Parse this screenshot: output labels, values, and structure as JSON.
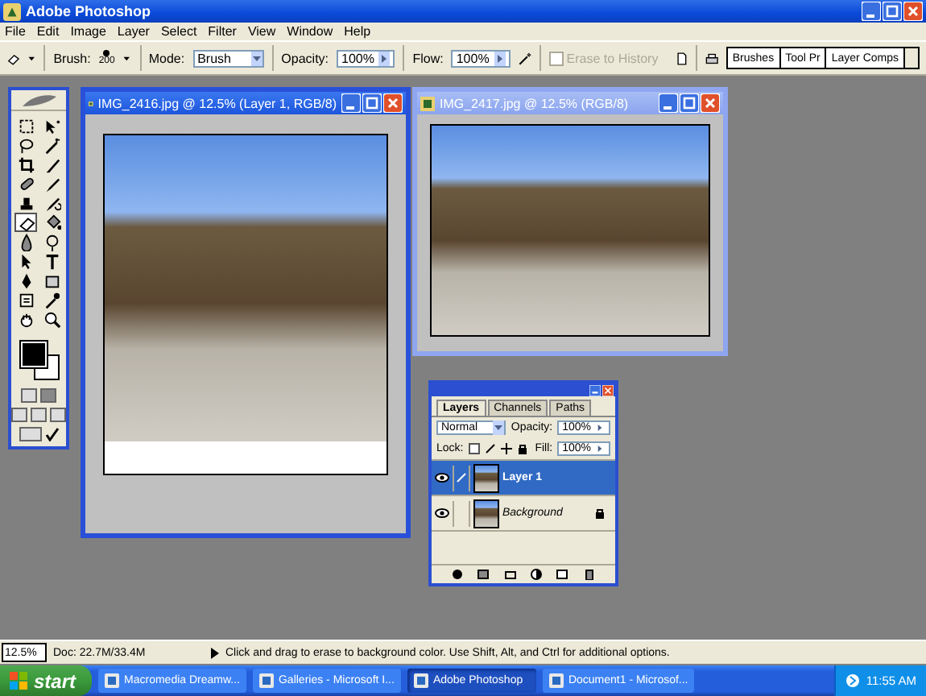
{
  "window": {
    "title": "Adobe Photoshop"
  },
  "menu": [
    "File",
    "Edit",
    "Image",
    "Layer",
    "Select",
    "Filter",
    "View",
    "Window",
    "Help"
  ],
  "options_bar": {
    "brush_label": "Brush:",
    "brush_size": "200",
    "mode_label": "Mode:",
    "mode": "Brush",
    "opacity_label": "Opacity:",
    "opacity": "100%",
    "flow_label": "Flow:",
    "flow": "100%",
    "erase_to_history": {
      "label": "Erase to History",
      "checked": false,
      "disabled": true
    },
    "palette_well": [
      {
        "label": "Brushes"
      },
      {
        "label": "Tool Pr"
      },
      {
        "label": "Layer Comps"
      }
    ]
  },
  "tools": [
    {
      "kind": "marquee",
      "selected": false
    },
    {
      "kind": "move",
      "selected": false
    },
    {
      "kind": "lasso",
      "selected": false
    },
    {
      "kind": "wand",
      "selected": false
    },
    {
      "kind": "crop",
      "selected": false
    },
    {
      "kind": "slice",
      "selected": false
    },
    {
      "kind": "healing",
      "selected": false
    },
    {
      "kind": "brush",
      "selected": false
    },
    {
      "kind": "stamp",
      "selected": false
    },
    {
      "kind": "history",
      "selected": false
    },
    {
      "kind": "eraser",
      "selected": true
    },
    {
      "kind": "bucket",
      "selected": false
    },
    {
      "kind": "blur",
      "selected": false
    },
    {
      "kind": "dodge",
      "selected": false
    },
    {
      "kind": "path",
      "selected": false
    },
    {
      "kind": "type",
      "selected": false
    },
    {
      "kind": "pen",
      "selected": false
    },
    {
      "kind": "shape",
      "selected": false
    },
    {
      "kind": "notes",
      "selected": false
    },
    {
      "kind": "eyedropper",
      "selected": false
    },
    {
      "kind": "hand",
      "selected": false
    },
    {
      "kind": "zoom",
      "selected": false
    }
  ],
  "documents": [
    {
      "title": "IMG_2416.jpg @ 12.5% (Layer 1, RGB/8)",
      "active": true
    },
    {
      "title": "IMG_2417.jpg @ 12.5% (RGB/8)",
      "active": false
    }
  ],
  "layers_palette": {
    "tabs": [
      {
        "label": "Layers",
        "selected": true
      },
      {
        "label": "Channels",
        "selected": false
      },
      {
        "label": "Paths",
        "selected": false
      }
    ],
    "blend_mode": "Normal",
    "opacity_label": "Opacity:",
    "opacity": "100%",
    "lock_label": "Lock:",
    "fill_label": "Fill:",
    "fill": "100%",
    "layers": [
      {
        "name": "Layer 1",
        "selected": true,
        "visible": true,
        "locked": false
      },
      {
        "name": "Background",
        "selected": false,
        "visible": true,
        "locked": true
      }
    ]
  },
  "status_bar": {
    "zoom": "12.5%",
    "doc": "Doc: 22.7M/33.4M",
    "hint": "Click and drag to erase to background color.  Use Shift, Alt, and Ctrl for additional options."
  },
  "taskbar": {
    "start": "start",
    "items": [
      {
        "label": "Macromedia Dreamw...",
        "selected": false
      },
      {
        "label": "Galleries - Microsoft I...",
        "selected": false
      },
      {
        "label": "Adobe Photoshop",
        "selected": true
      },
      {
        "label": "Document1 - Microsof...",
        "selected": false
      }
    ],
    "clock": "11:55 AM"
  }
}
